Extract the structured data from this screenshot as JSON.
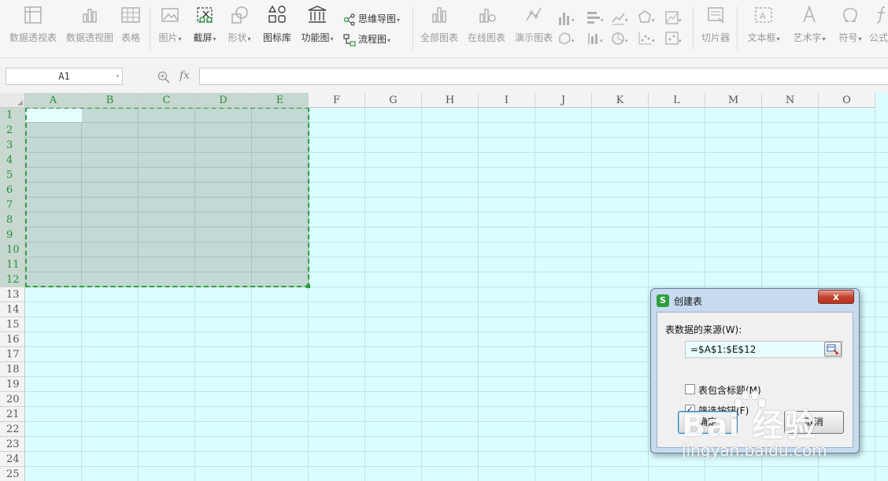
{
  "ribbon": {
    "pivot_table": "数据透视表",
    "pivot_chart": "数据透视图",
    "table": "表格",
    "picture": "图片",
    "screenshot": "截屏",
    "shape": "形状",
    "icon_library": "图标库",
    "function_chart": "功能图",
    "mind_map": "思维导图",
    "flowchart": "流程图",
    "all_charts": "全部图表",
    "online_charts": "在线图表",
    "demo_charts": "演示图表",
    "slicer": "切片器",
    "textbox": "文本框",
    "word_art": "艺术字",
    "symbol": "符号",
    "formula": "公式"
  },
  "formula_bar": {
    "cell_ref": "A1",
    "fx": "fx",
    "value": ""
  },
  "columns": [
    "A",
    "B",
    "C",
    "D",
    "E",
    "F",
    "G",
    "H",
    "I",
    "J",
    "K",
    "L",
    "M",
    "N",
    "O"
  ],
  "selected_columns": [
    "A",
    "B",
    "C",
    "D",
    "E"
  ],
  "rows": [
    "1",
    "2",
    "3",
    "4",
    "5",
    "6",
    "7",
    "8",
    "9",
    "10",
    "11",
    "12",
    "13",
    "14",
    "15",
    "16",
    "17",
    "18",
    "19",
    "20",
    "21",
    "22",
    "23",
    "24",
    "25"
  ],
  "selected_rows": 12,
  "colors": {
    "sheet_bg": "#dbfdff",
    "selection": "#c3d9d6",
    "marquee": "#2e9e3f",
    "dialog_frame": "#c7dbef"
  },
  "dialog": {
    "title": "创建表",
    "close": "x",
    "source_label": "表数据的来源(W):",
    "range_value": "=$A$1:$E$12",
    "header_checkbox_label": "表包含标题(M)",
    "header_checked": false,
    "filter_checkbox_label": "筛选按钮(F)",
    "filter_checked": true,
    "ok": "确定",
    "cancel": "取消"
  },
  "watermark": {
    "brand": "Bai 经验",
    "site": "jingyan.baidu.com"
  }
}
